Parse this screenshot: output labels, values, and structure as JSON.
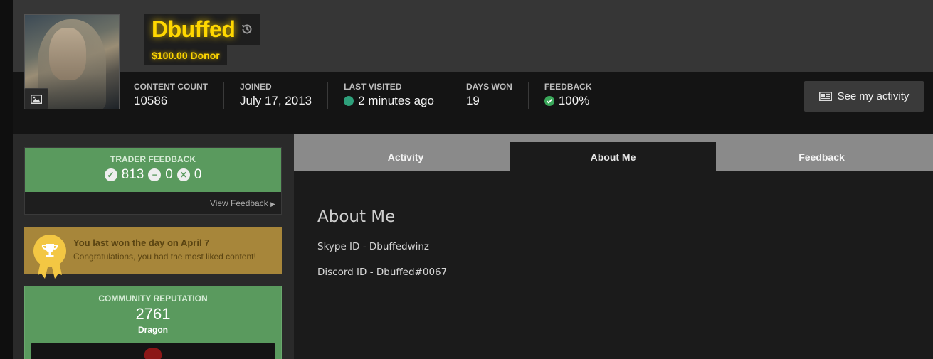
{
  "profile": {
    "username": "Dbuffed",
    "title": "$100.00 Donor",
    "name_color": "#ffd700"
  },
  "stats": [
    {
      "label": "Content Count",
      "value": "10586",
      "icon": ""
    },
    {
      "label": "Joined",
      "value": "July 17, 2013",
      "icon": ""
    },
    {
      "label": "Last Visited",
      "value": "2 minutes ago",
      "icon": "online-dot-icon"
    },
    {
      "label": "Days Won",
      "value": "19",
      "icon": ""
    },
    {
      "label": "Feedback",
      "value": "100%",
      "icon": "check-circle-icon"
    }
  ],
  "actions": {
    "see_activity": "See my activity"
  },
  "trader_feedback": {
    "title": "Trader Feedback",
    "positive": "813",
    "neutral": "0",
    "negative": "0",
    "view_link": "View Feedback",
    "color": "#5a9a5e"
  },
  "day_won": {
    "title": "You last won the day on April 7",
    "subtitle": "Congratulations, you had the most liked content!",
    "color": "#a7863a"
  },
  "reputation": {
    "title": "Community Reputation",
    "value": "2761",
    "rank": "Dragon"
  },
  "tabs": [
    {
      "label": "Activity",
      "active": false
    },
    {
      "label": "About Me",
      "active": true
    },
    {
      "label": "Feedback",
      "active": false
    }
  ],
  "about": {
    "heading": "About Me",
    "lines": [
      "Skype ID - Dbuffedwinz",
      "Discord ID - Dbuffed#0067"
    ]
  }
}
